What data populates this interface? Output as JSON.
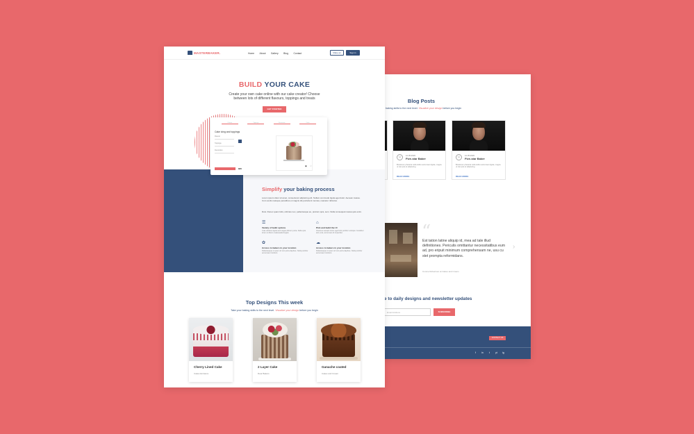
{
  "colors": {
    "background": "#e8686b",
    "primary": "#34507a",
    "accent": "#e8686b"
  },
  "back": {
    "blog_title": "Blog Posts",
    "blog_sub_pre": "baking skills to the next level. ",
    "blog_sub_accent": "Visualize your design",
    "blog_sub_post": " before you begin",
    "cards": [
      {
        "meta": "12.05.2020",
        "name": "Five-star Baker",
        "text": "Brutlonum pharetra nulla iudico accumsan ligula, magna ut nisi quis et adipiscing.",
        "more": "READ MORE"
      },
      {
        "meta": "12.05.2020",
        "name": "Five-star Baker",
        "text": "Brutlonum pharetra nulla iudico accumsan ligula, magna ut nisi quis et adipiscing.",
        "more": "READ MORE"
      }
    ],
    "quote": "Est tation latine aliquip id, mea ad tale illud definitiones. Periculis omittantur necessitatibus eum ad, pro eripuit minimum comprehensam ne, usu cu stet prompta reformidans.",
    "quote_author": "Connie Robertson at Cakes and Cream",
    "newsletter_title": "e to daily designs and newsletter updates",
    "email_placeholder": "Email Address",
    "subscribe": "SUBSCRIBE",
    "footer_btn": "CONTACT US",
    "social": [
      "f",
      "in",
      "t",
      "yt",
      "ig"
    ]
  },
  "nav": {
    "logo": "MASTERBAKER.",
    "items": [
      "Home",
      "About",
      "Gallery",
      "Blog",
      "Contact"
    ],
    "login": "Make an",
    "signup": "Sign in"
  },
  "hero": {
    "title_accent": "BUILD",
    "title_rest": " YOUR CAKE",
    "text": "Create your own cake online with our cake creator! Choose between lots of different flavours, toppings and treats",
    "button": "GET STARTED"
  },
  "mock": {
    "tabs": [
      "Flavour",
      "Toppings",
      "Decoration",
      "Order"
    ],
    "title": "Cake icing and toppings",
    "rows": [
      "Flavour",
      "Toppings",
      "Decoration"
    ],
    "price": "$65"
  },
  "simplify": {
    "title_accent": "Simplify",
    "title_rest": " your baking process",
    "p1": "Lorem ipsum dolor sit amet, consectetur adipiscing elit. Nullam commodo ligula eget dolor. Aenean massa. Cum sociis natoque penatibus et magnis dis parturient montes, nascetur ridiculus.",
    "p2": "Duis. Donec quam felis, ultricies nec, pellentesque eu, pretium quis, sem. Nulla consequat massa quis enim.",
    "features": [
      {
        "icon": "☰",
        "h": "Variety of build options",
        "p": "Cras ultricies ligula sed magna dictum porta. Nulla quis lorem ut libero malesuada feugiat."
      },
      {
        "icon": "⌂",
        "h": "Pick and build the UI",
        "p": "Vivamus suscipit tortor eget felis porttitor volutpat. Curabitur arcu erat, accumsan id imperdiet."
      },
      {
        "icon": "✿",
        "h": "Access to bakers in your location",
        "p": "Pellentesque in ipsum id orci porta dapibus. Nulla porttitor accumsan tincidunt."
      },
      {
        "icon": "☁",
        "h": "Access to bakers in your location",
        "p": "Pellentesque in ipsum id orci porta dapibus. Nulla porttitor accumsan tincidunt."
      }
    ]
  },
  "top": {
    "title": "Top Designs This week",
    "sub_pre": "Take your baking skills to the next level. ",
    "sub_accent": "Visualize your design",
    "sub_post": " before you begin",
    "cards": [
      {
        "name": "Cherry Lined Cake",
        "by": "Cakes Entrance"
      },
      {
        "name": "2 Layer Cake",
        "by": "Dear Bakers"
      },
      {
        "name": "Ganache coated",
        "by": "Cakes and Cream"
      }
    ]
  }
}
